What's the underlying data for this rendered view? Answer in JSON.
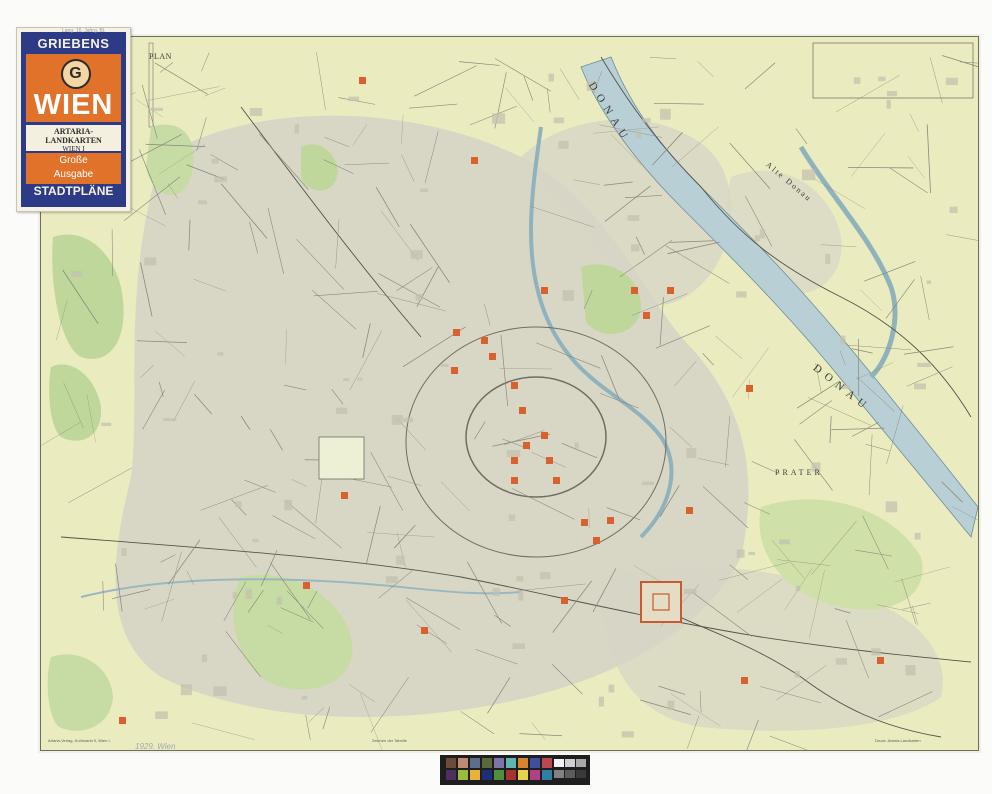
{
  "cover": {
    "brand": "GRIEBENS",
    "logo": "G",
    "city": "WIEN",
    "publisher": "ARTARIA-LANDKARTEN",
    "publisher_sub": "WIEN I",
    "edition": "Große\nAusgabe",
    "series": "STADTPLÄNE",
    "colors": {
      "frame": "#2d3a85",
      "accent": "#e0722a",
      "paper": "#f4efdf"
    }
  },
  "map": {
    "title_fragment": "PLAN",
    "labels": {
      "danube_a": "DONAU",
      "danube_b": "DONAU",
      "prater": "PRATER",
      "alte_donau": "Alte Donau"
    },
    "colors": {
      "paper": "#eaecbf",
      "built_up": "#d7d6c6",
      "parks": "#bfd79a",
      "water": "#b8cfd6",
      "landmarks": "#d8612d",
      "streets": "#7a7866"
    }
  },
  "notes": {
    "corner": "Lang. 16. Jahrg. Bl.",
    "pencil": "1929. Wien",
    "footer_left": "Artaria-Verlag, Kohlmarkt 9, Wien I.",
    "footer_center": "Zeichen der Tabelle",
    "footer_right": "Druck: Artaria-Landkarten"
  },
  "color_target": {
    "swatches": [
      "#6b4b3a",
      "#c08a74",
      "#5c6e8e",
      "#5b6a3c",
      "#7c76a8",
      "#5fb7b0",
      "#d9842b",
      "#3f4f9c",
      "#b9484f",
      "#4e2f5e",
      "#9bbb3a",
      "#e6b23a",
      "#1d2e7b",
      "#4f8f3f",
      "#a8332f",
      "#e5d44a",
      "#b33e8a",
      "#2f7fa3"
    ],
    "grays": [
      "#f2f2f2",
      "#cfcfcf",
      "#a9a9a9",
      "#828282",
      "#5c5c5c",
      "#3a3a3a"
    ]
  }
}
